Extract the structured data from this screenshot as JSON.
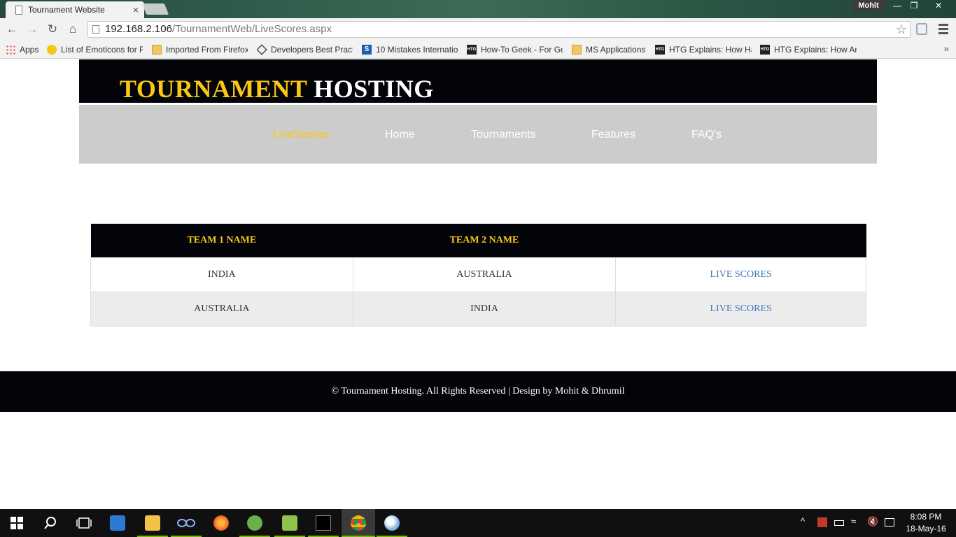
{
  "browser": {
    "tab_title": "Tournament Website",
    "tab_close": "×",
    "user": "Mohit",
    "window_controls": {
      "minimize": "—",
      "restore": "❐",
      "close": "✕"
    },
    "url_host": "192.168.2.106",
    "url_path": "/TournamentWeb/LiveScores.aspx",
    "icons": {
      "back": "arrow-left-icon",
      "forward": "arrow-right-icon",
      "reload": "reload-icon",
      "home": "home-icon",
      "star": "star-icon",
      "menu": "hamburger-icon"
    }
  },
  "bookmarks": [
    {
      "label": "Apps",
      "icon": "apps-grid-icon"
    },
    {
      "label": "List of Emoticons for F",
      "icon": "smiley-icon"
    },
    {
      "label": "Imported From Firefox",
      "icon": "folder-icon"
    },
    {
      "label": "Developers Best Pract",
      "icon": "diamond-icon"
    },
    {
      "label": "10 Mistakes Internatio",
      "icon": "s-icon"
    },
    {
      "label": "How-To Geek - For Ge",
      "icon": "htg-icon"
    },
    {
      "label": "MS Applications",
      "icon": "folder-icon"
    },
    {
      "label": "HTG Explains: How Ha",
      "icon": "htg-icon"
    },
    {
      "label": "HTG Explains: How An",
      "icon": "htg-icon"
    }
  ],
  "site": {
    "logo_word1": "TOURNAMENT",
    "logo_word2": "HOSTING",
    "nav": [
      {
        "label": "LiveScores",
        "active": true
      },
      {
        "label": "Home",
        "active": false
      },
      {
        "label": "Tournaments",
        "active": false
      },
      {
        "label": "Features",
        "active": false
      },
      {
        "label": "FAQ's",
        "active": false
      }
    ],
    "table": {
      "headers": [
        "TEAM 1 NAME",
        "TEAM 2 NAME",
        ""
      ],
      "rows": [
        {
          "team1": "INDIA",
          "team2": "AUSTRALIA",
          "link": "LIVE SCORES"
        },
        {
          "team1": "AUSTRALIA",
          "team2": "INDIA",
          "link": "LIVE SCORES"
        }
      ]
    },
    "footer": "© Tournament Hosting. All Rights Reserved | Design by Mohit & Dhrumil"
  },
  "taskbar": {
    "time": "8:08 PM",
    "date": "18-May-16",
    "tray_arrow": "^"
  },
  "colors": {
    "accent": "#fac712",
    "header_bg": "#02040a",
    "nav_bg": "#cccccc",
    "link": "#3d7ab8"
  }
}
